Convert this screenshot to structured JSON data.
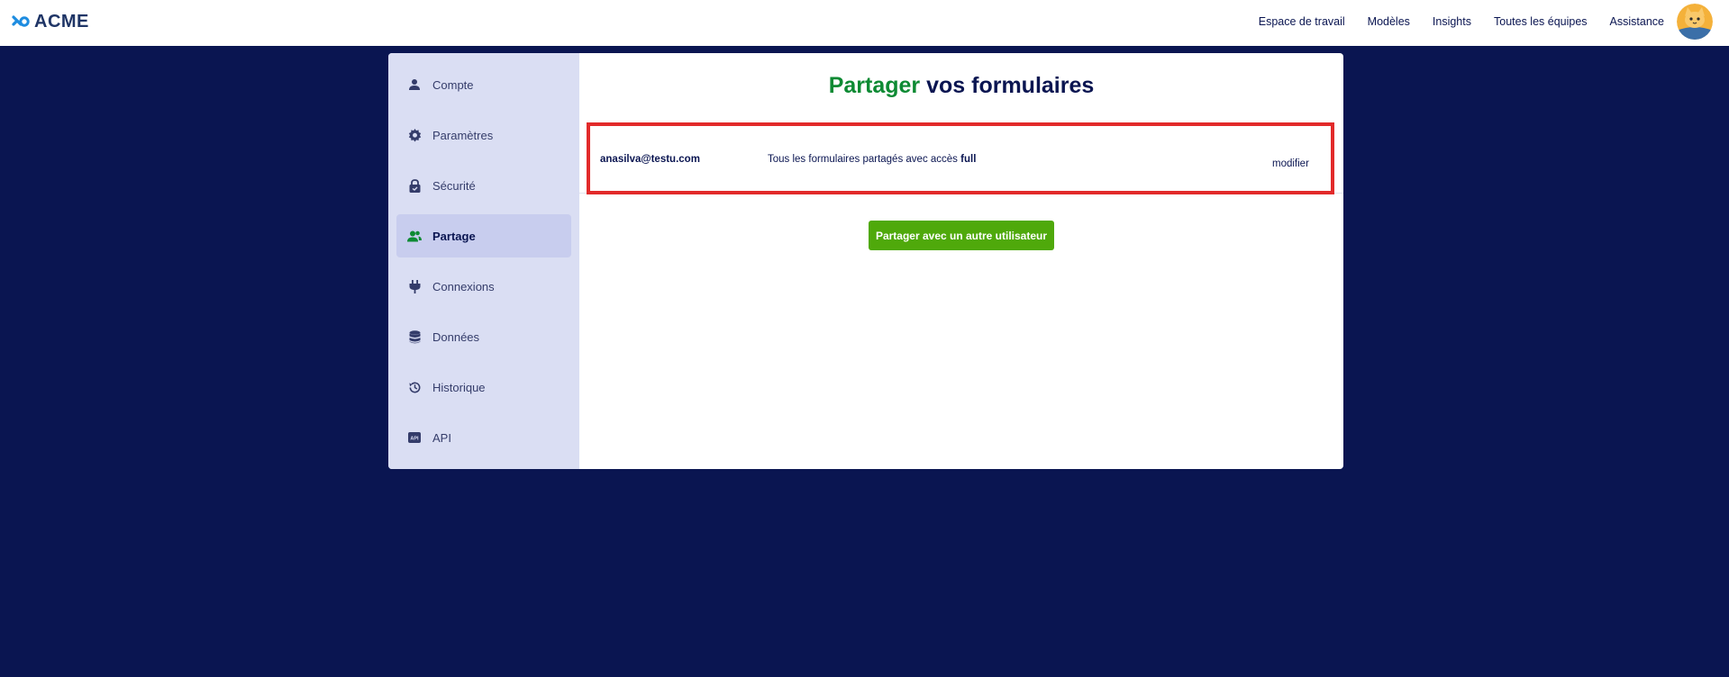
{
  "brand": {
    "name": "ACME"
  },
  "topnav": {
    "items": [
      {
        "label": "Espace de travail"
      },
      {
        "label": "Modèles"
      },
      {
        "label": "Insights"
      },
      {
        "label": "Toutes les équipes"
      },
      {
        "label": "Assistance"
      }
    ]
  },
  "sidebar": {
    "items": [
      {
        "label": "Compte",
        "icon": "user-icon"
      },
      {
        "label": "Paramètres",
        "icon": "gear-icon"
      },
      {
        "label": "Sécurité",
        "icon": "lock-icon"
      },
      {
        "label": "Partage",
        "icon": "users-icon",
        "active": true
      },
      {
        "label": "Connexions",
        "icon": "plug-icon"
      },
      {
        "label": "Données",
        "icon": "database-icon"
      },
      {
        "label": "Historique",
        "icon": "history-icon"
      },
      {
        "label": "API",
        "icon": "api-icon"
      }
    ]
  },
  "main": {
    "title_accent": "Partager",
    "title_rest": " vos formulaires",
    "share": {
      "email": "anasilva@testu.com",
      "description": "Tous les formulaires partagés avec accès ",
      "access": "full",
      "edit_label": "modifier"
    },
    "share_button_label": "Partager avec un autre utilisateur"
  },
  "colors": {
    "background": "#0a1551",
    "accent_green": "#0d8a33",
    "button_green": "#4fa90b",
    "sidebar_bg": "#dadef3",
    "highlight_red": "#e22a2a"
  }
}
